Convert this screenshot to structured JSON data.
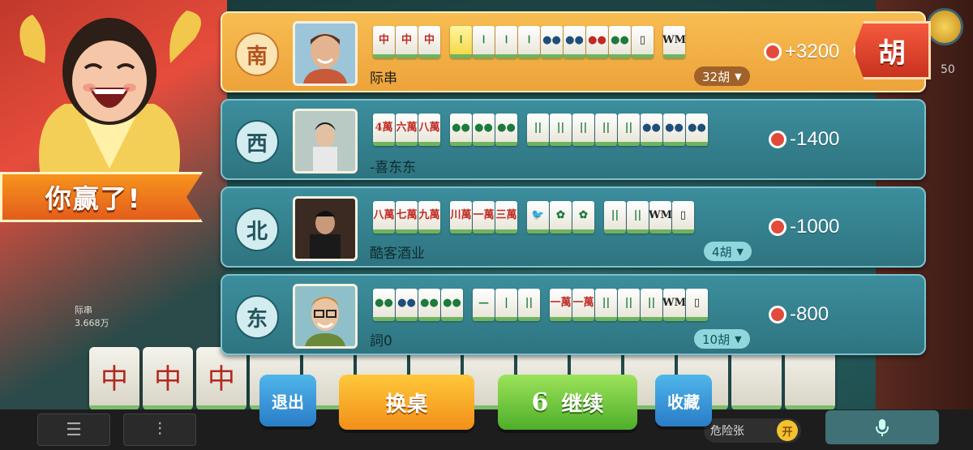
{
  "win_banner": "你赢了!",
  "rows": [
    {
      "wind": "南",
      "name": "际串",
      "score": "+3200",
      "fan": "32胡",
      "winner": true,
      "hu_label": "胡",
      "groups": [
        [
          "中",
          "中",
          "中"
        ],
        [
          "𝍷",
          "𝍷",
          "𝍷",
          "𝍷",
          "●●",
          "●●",
          "●●",
          "●●",
          "▯",
          "WM"
        ]
      ]
    },
    {
      "wind": "西",
      "name": "-喜东东",
      "score": "-1400",
      "fan": "",
      "winner": false,
      "groups": [
        [
          "4萬",
          "六萬",
          "八萬"
        ],
        [
          "●●",
          "●●",
          "●●"
        ],
        [
          "||",
          "||",
          "||",
          "||",
          "||",
          "●●",
          "●●",
          "●●"
        ]
      ]
    },
    {
      "wind": "北",
      "name": "酷客酒业",
      "score": "-1000",
      "fan": "4胡",
      "winner": false,
      "groups": [
        [
          "八萬",
          "七萬",
          "九萬"
        ],
        [
          "川萬",
          "一萬",
          "三萬"
        ],
        [
          "🐦",
          "✿",
          "✿"
        ],
        [
          "||",
          "||",
          "WM",
          "▯"
        ]
      ]
    },
    {
      "wind": "东",
      "name": "",
      "name_display": "詞0",
      "score": "-800",
      "fan": "10胡",
      "winner": false,
      "groups": [
        [
          "●●",
          "●●",
          "●●",
          "●●"
        ],
        [
          "—",
          "|",
          "||"
        ],
        [
          "一萬",
          "一萬",
          "||",
          "||",
          "||",
          "WM",
          "▯"
        ]
      ]
    }
  ],
  "buttons": {
    "exit": "退出",
    "swap": "换桌",
    "continue_count": "6",
    "continue": "继续",
    "favorite": "收藏"
  },
  "background": {
    "danger_label": "危险张",
    "danger_toggle": "开",
    "left_player_name": "际串",
    "left_player_coins": "3.668万",
    "top_right_num": "50"
  }
}
